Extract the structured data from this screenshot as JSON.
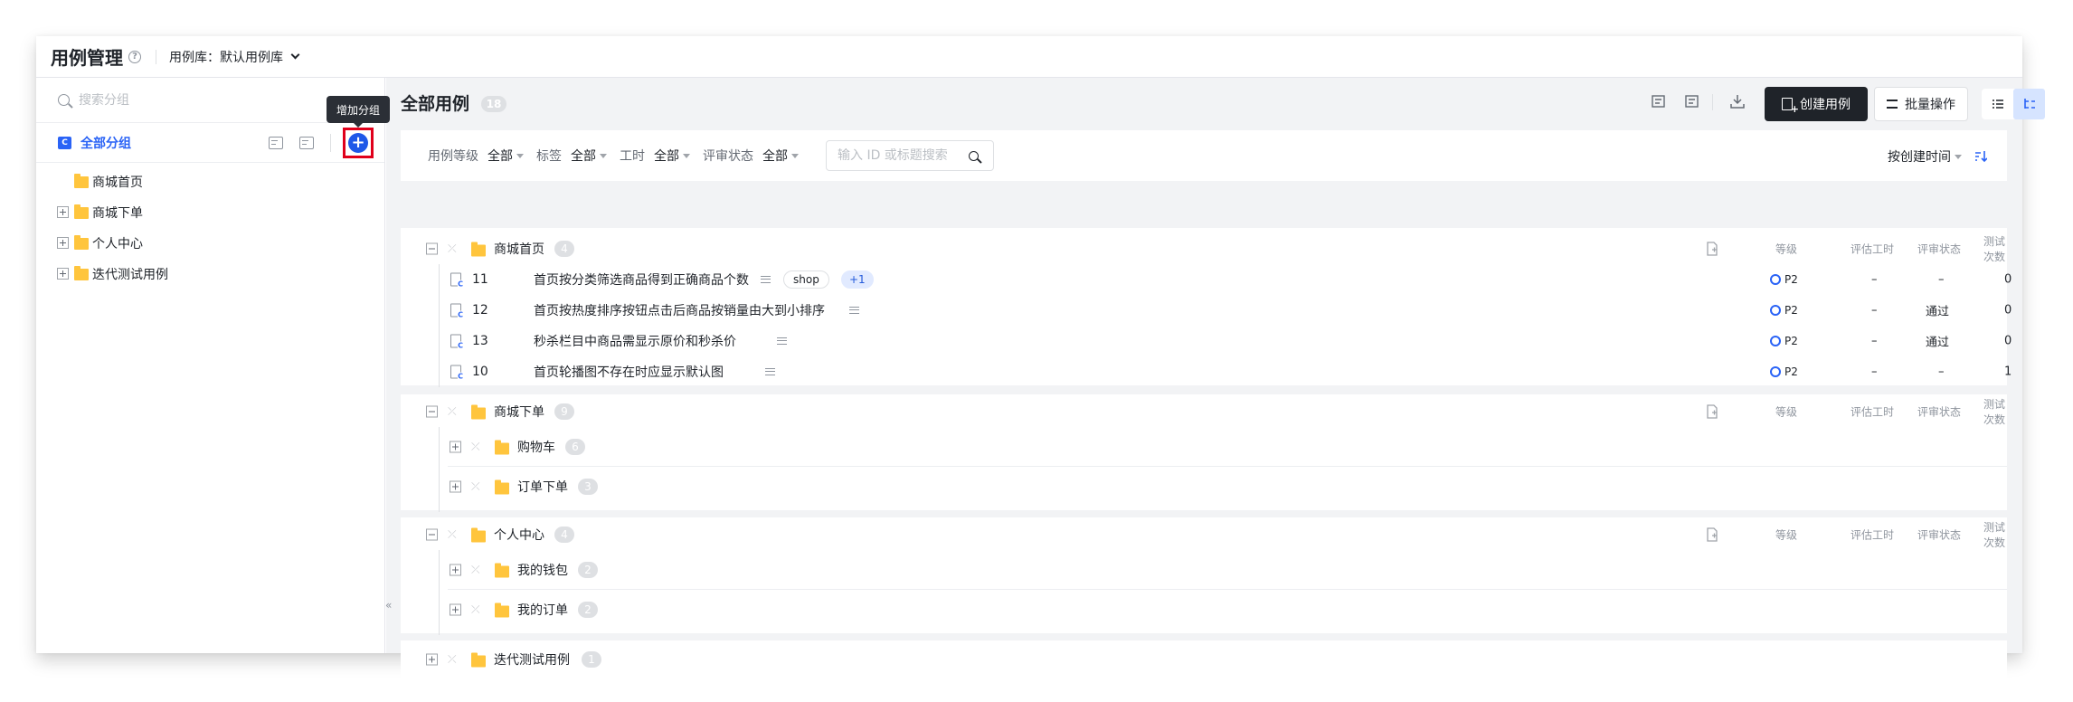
{
  "header": {
    "title": "用例管理",
    "help_icon": "?",
    "lib_label": "用例库：",
    "lib_value": "默认用例库"
  },
  "sidebar": {
    "search_placeholder": "搜索分组",
    "all_icon": "C",
    "all_label": "全部分组",
    "add_tooltip": "增加分组",
    "add_symbol": "+",
    "collapse_symbol": "«",
    "items": [
      {
        "label": "商城首页",
        "expandable": false
      },
      {
        "label": "商城下单",
        "expandable": true
      },
      {
        "label": "个人中心",
        "expandable": true
      },
      {
        "label": "迭代测试用例",
        "expandable": true
      }
    ]
  },
  "main": {
    "title": "全部用例",
    "count": "18",
    "create_label": "创建用例",
    "batch_label": "批量操作",
    "filters": [
      {
        "label": "用例等级",
        "value": "全部"
      },
      {
        "label": "标签",
        "value": "全部"
      },
      {
        "label": "工时",
        "value": "全部"
      },
      {
        "label": "评审状态",
        "value": "全部"
      }
    ],
    "search_placeholder": "输入 ID 或标题搜索",
    "sort_label": "按创建时间",
    "columns": {
      "level": "等级",
      "hours": "评估工时",
      "review": "评审状态",
      "runs": "测试次数"
    },
    "groups": [
      {
        "name": "商城首页",
        "count": "4",
        "cases": [
          {
            "id": "11",
            "title": "首页按分类筛选商品得到正确商品个数",
            "tags": [
              "shop"
            ],
            "more": "+1",
            "level": "P2",
            "hours": "–",
            "review": "–",
            "runs": "0"
          },
          {
            "id": "12",
            "title": "首页按热度排序按钮点击后商品按销量由大到小排序",
            "tags": [],
            "more": "",
            "level": "P2",
            "hours": "–",
            "review": "通过",
            "runs": "0"
          },
          {
            "id": "13",
            "title": "秒杀栏目中商品需显示原价和秒杀价",
            "tags": [],
            "more": "",
            "level": "P2",
            "hours": "–",
            "review": "通过",
            "runs": "0"
          },
          {
            "id": "10",
            "title": "首页轮播图不存在时应显示默认图",
            "tags": [],
            "more": "",
            "level": "P2",
            "hours": "–",
            "review": "–",
            "runs": "1"
          }
        ]
      },
      {
        "name": "商城下单",
        "count": "9",
        "subgroups": [
          {
            "name": "购物车",
            "count": "6"
          },
          {
            "name": "订单下单",
            "count": "3"
          }
        ]
      },
      {
        "name": "个人中心",
        "count": "4",
        "subgroups": [
          {
            "name": "我的钱包",
            "count": "2"
          },
          {
            "name": "我的订单",
            "count": "2"
          }
        ]
      },
      {
        "name": "迭代测试用例",
        "count": "1"
      }
    ]
  }
}
